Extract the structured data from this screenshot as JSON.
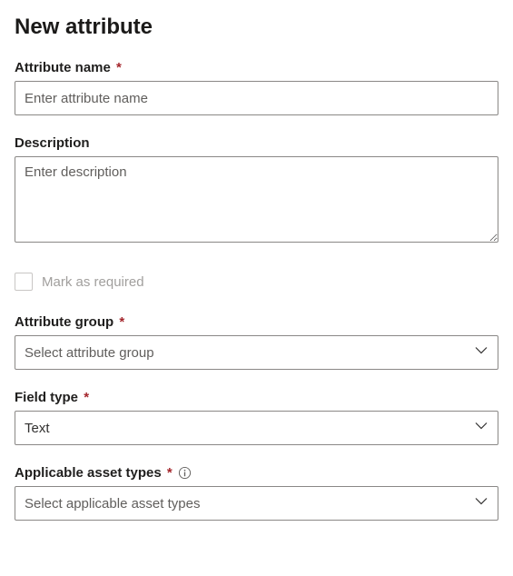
{
  "title": "New attribute",
  "fields": {
    "attribute_name": {
      "label": "Attribute name",
      "placeholder": "Enter attribute name",
      "value": ""
    },
    "description": {
      "label": "Description",
      "placeholder": "Enter description",
      "value": ""
    },
    "mark_required": {
      "label": "Mark as required",
      "checked": false
    },
    "attribute_group": {
      "label": "Attribute group",
      "placeholder": "Select attribute group",
      "value": ""
    },
    "field_type": {
      "label": "Field type",
      "value": "Text"
    },
    "applicable_asset_types": {
      "label": "Applicable asset types",
      "placeholder": "Select applicable asset types",
      "value": ""
    }
  },
  "required_marker": "*"
}
